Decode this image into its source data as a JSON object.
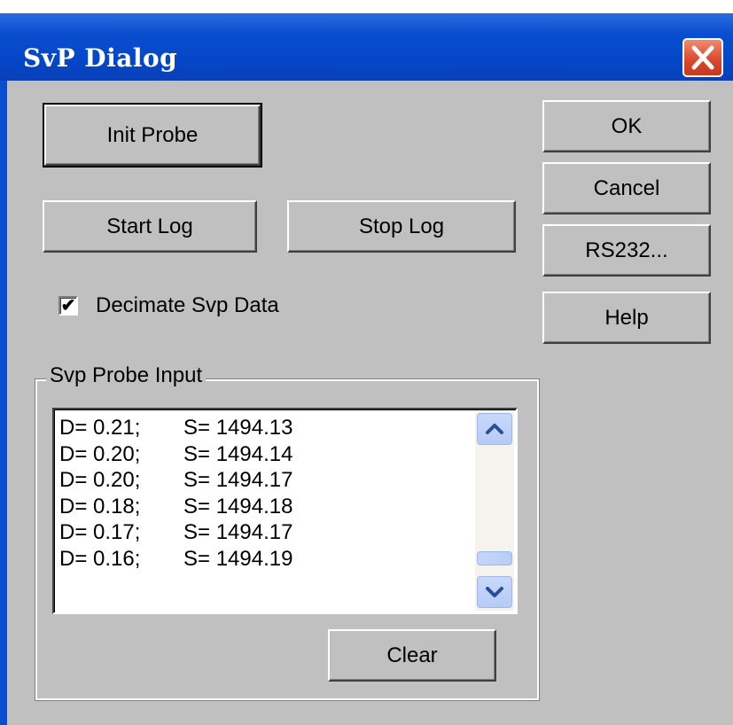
{
  "window": {
    "title": "SvP Dialog"
  },
  "buttons": {
    "init_probe": "Init Probe",
    "start_log": "Start Log",
    "stop_log": "Stop Log",
    "ok": "OK",
    "cancel": "Cancel",
    "rs232": "RS232...",
    "help": "Help",
    "clear": "Clear"
  },
  "decimate": {
    "label": "Decimate Svp Data",
    "checked": true,
    "check_glyph": "✔"
  },
  "probe_input": {
    "group_title": "Svp Probe Input",
    "rows": [
      {
        "d": "D= 0.21;",
        "s": "S= 1494.13"
      },
      {
        "d": "D= 0.20;",
        "s": "S= 1494.14"
      },
      {
        "d": "D= 0.20;",
        "s": "S= 1494.17"
      },
      {
        "d": "D= 0.18;",
        "s": "S= 1494.18"
      },
      {
        "d": "D= 0.17;",
        "s": "S= 1494.17"
      },
      {
        "d": "D= 0.16;",
        "s": "S= 1494.19"
      }
    ]
  },
  "icons": {
    "close": "close-icon",
    "scroll_up": "chevron-up-icon",
    "scroll_down": "chevron-down-icon"
  },
  "colors": {
    "titlebar": "#0a4ed0",
    "dialog_bg": "#c0c0c0",
    "close_button": "#d9462a",
    "scroll_arrow": "#b6cbf6"
  }
}
